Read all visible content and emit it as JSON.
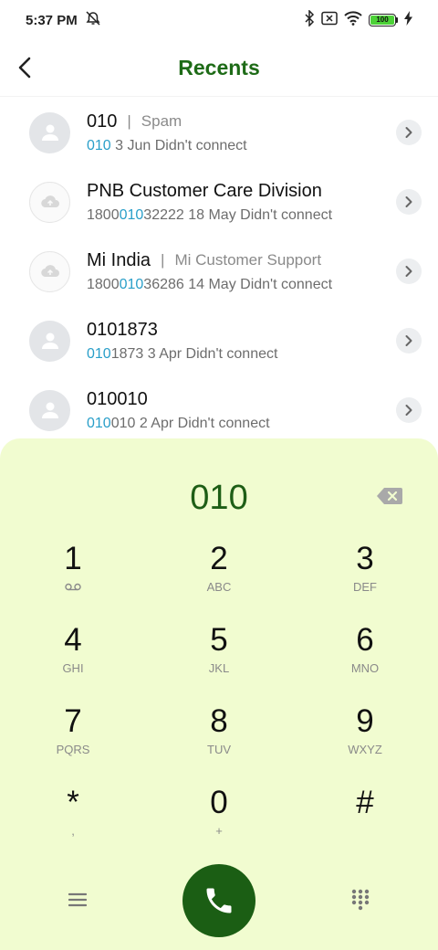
{
  "status": {
    "time": "5:37 PM",
    "battery": "100"
  },
  "header": {
    "title": "Recents"
  },
  "recents": [
    {
      "name": "010",
      "label": "Spam",
      "sub_hl_pre": "",
      "sub_hl": "010",
      "sub_rest": " 3 Jun Didn't connect",
      "avatar": "person"
    },
    {
      "name": "PNB Customer Care Division",
      "label": "",
      "sub_hl_pre": "1800",
      "sub_hl": "010",
      "sub_rest": "32222 18 May Didn't connect",
      "avatar": "cloud"
    },
    {
      "name": "Mi India",
      "label": "Mi Customer Support",
      "sub_hl_pre": "1800",
      "sub_hl": "010",
      "sub_rest": "36286 14 May Didn't connect",
      "avatar": "cloud"
    },
    {
      "name": "0101873",
      "label": "",
      "sub_hl_pre": "",
      "sub_hl": "010",
      "sub_rest": "1873 3 Apr Didn't connect",
      "avatar": "person"
    },
    {
      "name": "010010",
      "label": "",
      "sub_hl_pre": "",
      "sub_hl": "010",
      "sub_rest": "010 2 Apr Didn't connect",
      "avatar": "person"
    }
  ],
  "dialpad": {
    "number": "010",
    "keys": [
      {
        "digit": "1",
        "letters": "",
        "icon": "voicemail-icon"
      },
      {
        "digit": "2",
        "letters": "ABC"
      },
      {
        "digit": "3",
        "letters": "DEF"
      },
      {
        "digit": "4",
        "letters": "GHI"
      },
      {
        "digit": "5",
        "letters": "JKL"
      },
      {
        "digit": "6",
        "letters": "MNO"
      },
      {
        "digit": "7",
        "letters": "PQRS"
      },
      {
        "digit": "8",
        "letters": "TUV"
      },
      {
        "digit": "9",
        "letters": "WXYZ"
      },
      {
        "digit": "*",
        "letters": ","
      },
      {
        "digit": "0",
        "letters": "+"
      },
      {
        "digit": "#",
        "letters": ""
      }
    ]
  },
  "colors": {
    "accent": "#1e6b17",
    "highlight": "#2a9fc9",
    "dialpad_bg": "#f1fcd0",
    "call_button": "#1b5e14"
  }
}
